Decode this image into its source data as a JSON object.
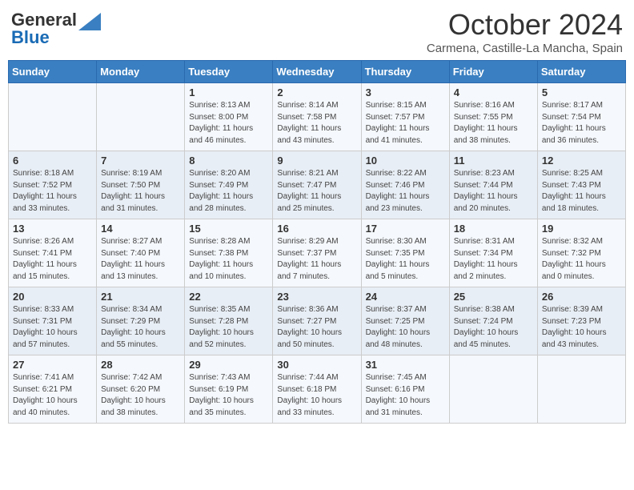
{
  "header": {
    "logo_general": "General",
    "logo_blue": "Blue",
    "month_title": "October 2024",
    "location": "Carmena, Castille-La Mancha, Spain"
  },
  "days_of_week": [
    "Sunday",
    "Monday",
    "Tuesday",
    "Wednesday",
    "Thursday",
    "Friday",
    "Saturday"
  ],
  "weeks": [
    [
      {
        "day": "",
        "info": ""
      },
      {
        "day": "",
        "info": ""
      },
      {
        "day": "1",
        "info": "Sunrise: 8:13 AM\nSunset: 8:00 PM\nDaylight: 11 hours and 46 minutes."
      },
      {
        "day": "2",
        "info": "Sunrise: 8:14 AM\nSunset: 7:58 PM\nDaylight: 11 hours and 43 minutes."
      },
      {
        "day": "3",
        "info": "Sunrise: 8:15 AM\nSunset: 7:57 PM\nDaylight: 11 hours and 41 minutes."
      },
      {
        "day": "4",
        "info": "Sunrise: 8:16 AM\nSunset: 7:55 PM\nDaylight: 11 hours and 38 minutes."
      },
      {
        "day": "5",
        "info": "Sunrise: 8:17 AM\nSunset: 7:54 PM\nDaylight: 11 hours and 36 minutes."
      }
    ],
    [
      {
        "day": "6",
        "info": "Sunrise: 8:18 AM\nSunset: 7:52 PM\nDaylight: 11 hours and 33 minutes."
      },
      {
        "day": "7",
        "info": "Sunrise: 8:19 AM\nSunset: 7:50 PM\nDaylight: 11 hours and 31 minutes."
      },
      {
        "day": "8",
        "info": "Sunrise: 8:20 AM\nSunset: 7:49 PM\nDaylight: 11 hours and 28 minutes."
      },
      {
        "day": "9",
        "info": "Sunrise: 8:21 AM\nSunset: 7:47 PM\nDaylight: 11 hours and 25 minutes."
      },
      {
        "day": "10",
        "info": "Sunrise: 8:22 AM\nSunset: 7:46 PM\nDaylight: 11 hours and 23 minutes."
      },
      {
        "day": "11",
        "info": "Sunrise: 8:23 AM\nSunset: 7:44 PM\nDaylight: 11 hours and 20 minutes."
      },
      {
        "day": "12",
        "info": "Sunrise: 8:25 AM\nSunset: 7:43 PM\nDaylight: 11 hours and 18 minutes."
      }
    ],
    [
      {
        "day": "13",
        "info": "Sunrise: 8:26 AM\nSunset: 7:41 PM\nDaylight: 11 hours and 15 minutes."
      },
      {
        "day": "14",
        "info": "Sunrise: 8:27 AM\nSunset: 7:40 PM\nDaylight: 11 hours and 13 minutes."
      },
      {
        "day": "15",
        "info": "Sunrise: 8:28 AM\nSunset: 7:38 PM\nDaylight: 11 hours and 10 minutes."
      },
      {
        "day": "16",
        "info": "Sunrise: 8:29 AM\nSunset: 7:37 PM\nDaylight: 11 hours and 7 minutes."
      },
      {
        "day": "17",
        "info": "Sunrise: 8:30 AM\nSunset: 7:35 PM\nDaylight: 11 hours and 5 minutes."
      },
      {
        "day": "18",
        "info": "Sunrise: 8:31 AM\nSunset: 7:34 PM\nDaylight: 11 hours and 2 minutes."
      },
      {
        "day": "19",
        "info": "Sunrise: 8:32 AM\nSunset: 7:32 PM\nDaylight: 11 hours and 0 minutes."
      }
    ],
    [
      {
        "day": "20",
        "info": "Sunrise: 8:33 AM\nSunset: 7:31 PM\nDaylight: 10 hours and 57 minutes."
      },
      {
        "day": "21",
        "info": "Sunrise: 8:34 AM\nSunset: 7:29 PM\nDaylight: 10 hours and 55 minutes."
      },
      {
        "day": "22",
        "info": "Sunrise: 8:35 AM\nSunset: 7:28 PM\nDaylight: 10 hours and 52 minutes."
      },
      {
        "day": "23",
        "info": "Sunrise: 8:36 AM\nSunset: 7:27 PM\nDaylight: 10 hours and 50 minutes."
      },
      {
        "day": "24",
        "info": "Sunrise: 8:37 AM\nSunset: 7:25 PM\nDaylight: 10 hours and 48 minutes."
      },
      {
        "day": "25",
        "info": "Sunrise: 8:38 AM\nSunset: 7:24 PM\nDaylight: 10 hours and 45 minutes."
      },
      {
        "day": "26",
        "info": "Sunrise: 8:39 AM\nSunset: 7:23 PM\nDaylight: 10 hours and 43 minutes."
      }
    ],
    [
      {
        "day": "27",
        "info": "Sunrise: 7:41 AM\nSunset: 6:21 PM\nDaylight: 10 hours and 40 minutes."
      },
      {
        "day": "28",
        "info": "Sunrise: 7:42 AM\nSunset: 6:20 PM\nDaylight: 10 hours and 38 minutes."
      },
      {
        "day": "29",
        "info": "Sunrise: 7:43 AM\nSunset: 6:19 PM\nDaylight: 10 hours and 35 minutes."
      },
      {
        "day": "30",
        "info": "Sunrise: 7:44 AM\nSunset: 6:18 PM\nDaylight: 10 hours and 33 minutes."
      },
      {
        "day": "31",
        "info": "Sunrise: 7:45 AM\nSunset: 6:16 PM\nDaylight: 10 hours and 31 minutes."
      },
      {
        "day": "",
        "info": ""
      },
      {
        "day": "",
        "info": ""
      }
    ]
  ]
}
